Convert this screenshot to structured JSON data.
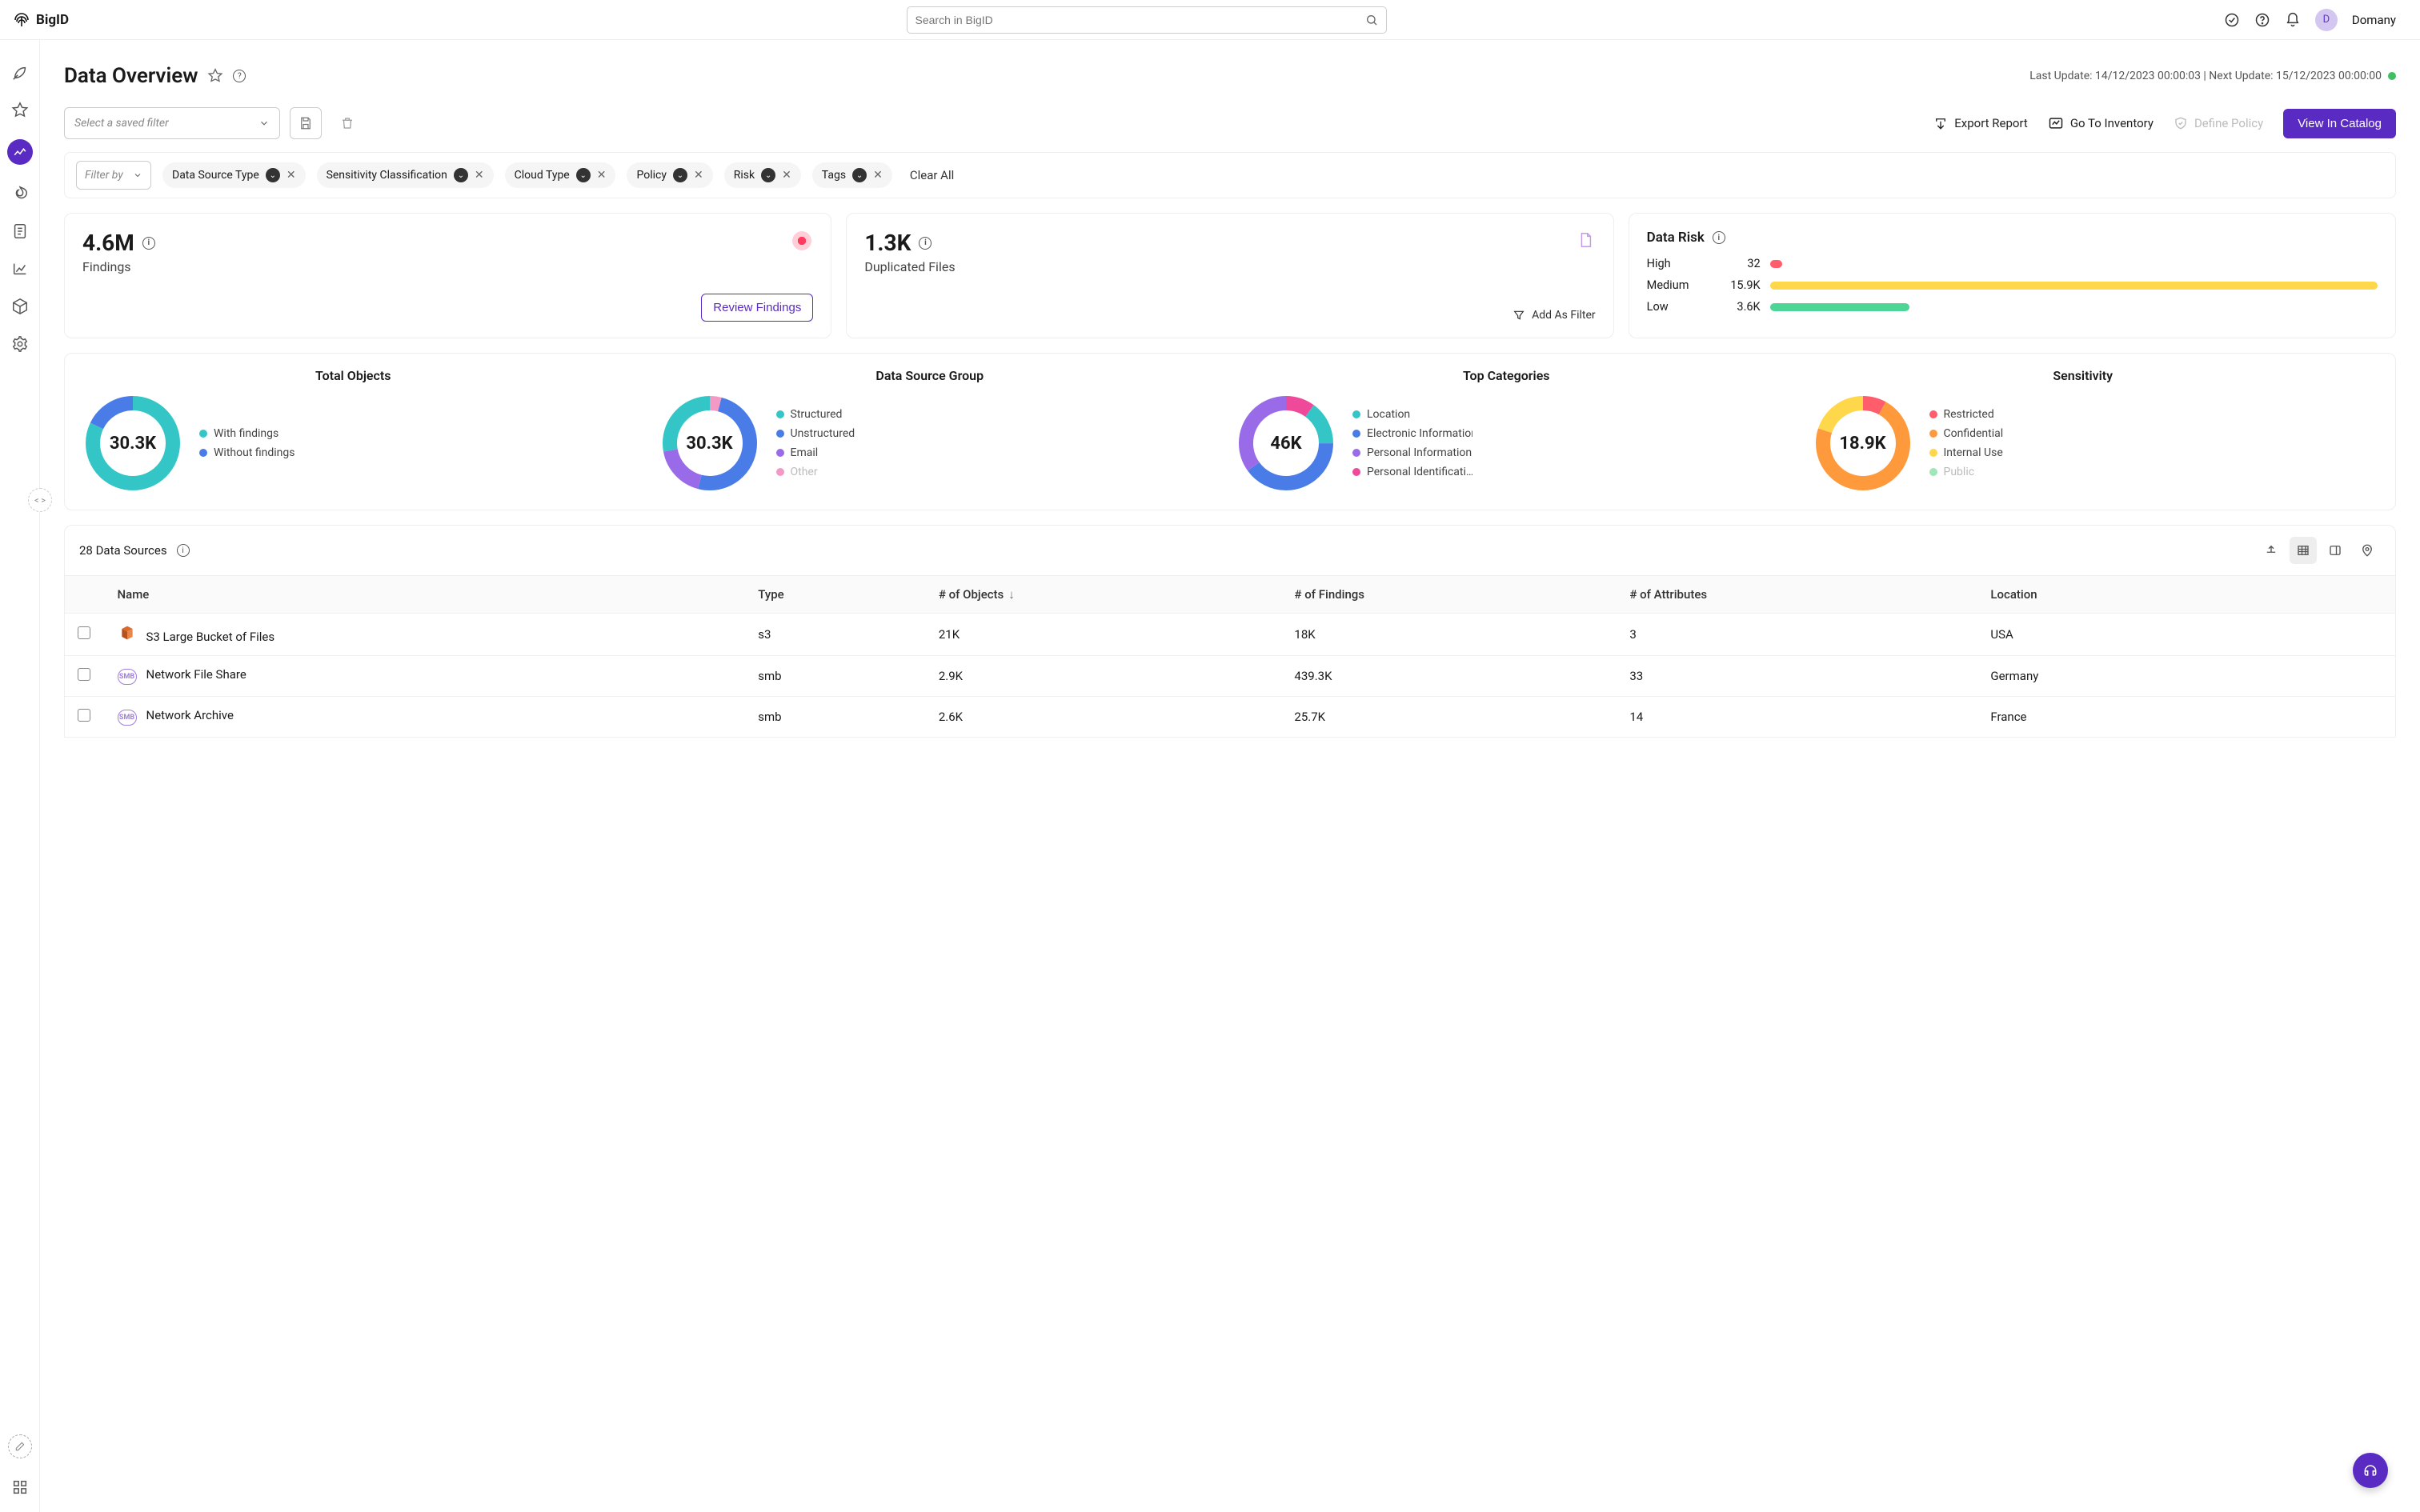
{
  "header": {
    "brand": "BigID",
    "search_placeholder": "Search in BigID",
    "username": "Domany",
    "avatar_initial": "D"
  },
  "page": {
    "title": "Data Overview",
    "last_update": "Last Update: 14/12/2023 00:00:03 | Next Update: 15/12/2023 00:00:00"
  },
  "toolbar": {
    "saved_filter_placeholder": "Select a saved filter",
    "export_report": "Export Report",
    "go_to_inventory": "Go To Inventory",
    "define_policy": "Define Policy",
    "view_in_catalog": "View In Catalog"
  },
  "filters": {
    "filter_by": "Filter by",
    "chips": [
      "Data Source Type",
      "Sensitivity Classification",
      "Cloud Type",
      "Policy",
      "Risk",
      "Tags"
    ],
    "clear_all": "Clear All"
  },
  "metrics": {
    "findings": {
      "value": "4.6M",
      "label": "Findings",
      "button": "Review Findings"
    },
    "duplicated": {
      "value": "1.3K",
      "label": "Duplicated Files",
      "button": "Add As Filter"
    },
    "risk": {
      "title": "Data Risk",
      "rows": [
        {
          "label": "High",
          "value": "32",
          "color": "#ff5c6c",
          "pct": 2
        },
        {
          "label": "Medium",
          "value": "15.9K",
          "color": "#ffd74a",
          "pct": 100
        },
        {
          "label": "Low",
          "value": "3.6K",
          "color": "#4dd596",
          "pct": 23
        }
      ]
    }
  },
  "donuts": [
    {
      "title": "Total Objects",
      "center": "30.3K",
      "legend": [
        {
          "label": "With findings",
          "color": "#34c6c6",
          "dim": false
        },
        {
          "label": "Without findings",
          "color": "#4a7ce8",
          "dim": false
        }
      ],
      "segments": [
        {
          "color": "#34c6c6",
          "pct": 82
        },
        {
          "color": "#4a7ce8",
          "pct": 18
        }
      ]
    },
    {
      "title": "Data Source Group",
      "center": "30.3K",
      "legend": [
        {
          "label": "Structured",
          "color": "#34c6c6",
          "dim": false
        },
        {
          "label": "Unstructured",
          "color": "#4a7ce8",
          "dim": false
        },
        {
          "label": "Email",
          "color": "#9a6be8",
          "dim": false
        },
        {
          "label": "Other",
          "color": "#f29ac5",
          "dim": true
        }
      ],
      "segments": [
        {
          "color": "#f29ac5",
          "pct": 4
        },
        {
          "color": "#4a7ce8",
          "pct": 50
        },
        {
          "color": "#9a6be8",
          "pct": 18
        },
        {
          "color": "#34c6c6",
          "pct": 28
        }
      ]
    },
    {
      "title": "Top Categories",
      "center": "46K",
      "legend": [
        {
          "label": "Location",
          "color": "#34c6c6",
          "dim": false
        },
        {
          "label": "Electronic Information",
          "color": "#4a7ce8",
          "dim": false
        },
        {
          "label": "Personal Information",
          "color": "#9a6be8",
          "dim": false
        },
        {
          "label": "Personal Identificati…",
          "color": "#ef4a9a",
          "dim": false
        }
      ],
      "segments": [
        {
          "color": "#ef4a9a",
          "pct": 10
        },
        {
          "color": "#34c6c6",
          "pct": 15
        },
        {
          "color": "#4a7ce8",
          "pct": 40
        },
        {
          "color": "#9a6be8",
          "pct": 35
        }
      ]
    },
    {
      "title": "Sensitivity",
      "center": "18.9K",
      "legend": [
        {
          "label": "Restricted",
          "color": "#ff5c6c",
          "dim": false
        },
        {
          "label": "Confidential",
          "color": "#ff9a3c",
          "dim": false
        },
        {
          "label": "Internal Use",
          "color": "#ffd74a",
          "dim": false
        },
        {
          "label": "Public",
          "color": "#9fe6b8",
          "dim": true
        }
      ],
      "segments": [
        {
          "color": "#ff5c6c",
          "pct": 8
        },
        {
          "color": "#ff9a3c",
          "pct": 72
        },
        {
          "color": "#ffd74a",
          "pct": 20
        }
      ]
    }
  ],
  "data_sources": {
    "count_label": "28 Data Sources",
    "columns": [
      "Name",
      "Type",
      "# of Objects",
      "# of Findings",
      "# of Attributes",
      "Location"
    ],
    "sort_column": "# of Objects",
    "rows": [
      {
        "icon": "s3",
        "name": "S3 Large Bucket of Files",
        "type": "s3",
        "objects": "21K",
        "findings": "18K",
        "attributes": "3",
        "location": "USA"
      },
      {
        "icon": "smb",
        "name": "Network File Share",
        "type": "smb",
        "objects": "2.9K",
        "findings": "439.3K",
        "attributes": "33",
        "location": "Germany"
      },
      {
        "icon": "smb",
        "name": "Network Archive",
        "type": "smb",
        "objects": "2.6K",
        "findings": "25.7K",
        "attributes": "14",
        "location": "France"
      }
    ]
  },
  "chart_data": [
    {
      "type": "bar",
      "title": "Data Risk",
      "categories": [
        "High",
        "Medium",
        "Low"
      ],
      "values": [
        32,
        15900,
        3600
      ],
      "value_labels": [
        "32",
        "15.9K",
        "3.6K"
      ],
      "colors": [
        "#ff5c6c",
        "#ffd74a",
        "#4dd596"
      ]
    },
    {
      "type": "pie",
      "title": "Total Objects",
      "total_label": "30.3K",
      "series": [
        {
          "name": "With findings",
          "pct": 82
        },
        {
          "name": "Without findings",
          "pct": 18
        }
      ]
    },
    {
      "type": "pie",
      "title": "Data Source Group",
      "total_label": "30.3K",
      "series": [
        {
          "name": "Structured",
          "pct": 28
        },
        {
          "name": "Unstructured",
          "pct": 50
        },
        {
          "name": "Email",
          "pct": 18
        },
        {
          "name": "Other",
          "pct": 4
        }
      ]
    },
    {
      "type": "pie",
      "title": "Top Categories",
      "total_label": "46K",
      "series": [
        {
          "name": "Location",
          "pct": 15
        },
        {
          "name": "Electronic Information",
          "pct": 40
        },
        {
          "name": "Personal Information",
          "pct": 35
        },
        {
          "name": "Personal Identification",
          "pct": 10
        }
      ]
    },
    {
      "type": "pie",
      "title": "Sensitivity",
      "total_label": "18.9K",
      "series": [
        {
          "name": "Restricted",
          "pct": 8
        },
        {
          "name": "Confidential",
          "pct": 72
        },
        {
          "name": "Internal Use",
          "pct": 20
        },
        {
          "name": "Public",
          "pct": 0
        }
      ]
    }
  ]
}
